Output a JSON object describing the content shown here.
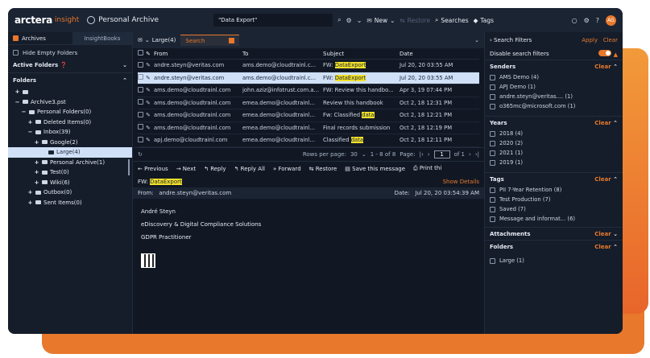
{
  "brand": {
    "name": "arctera",
    "sub": "insight"
  },
  "app_title": "Personal Archive",
  "top_search": {
    "value": "\"Data Export\""
  },
  "toolbar": {
    "new": "New",
    "restore": "Restore",
    "searches": "Searches",
    "tags": "Tags",
    "avatar": "AG"
  },
  "left_tabs": {
    "archives": "Archives",
    "insightbooks": "InsightBooks"
  },
  "hide_empty": "Hide Empty Folders",
  "active_folders": "Active Folders",
  "folders_label": "Folders",
  "tree": [
    {
      "label": "",
      "indent": 0,
      "pm": "+"
    },
    {
      "label": "Archive3.pst",
      "indent": 0,
      "pm": "−"
    },
    {
      "label": "Personal Folders(0)",
      "indent": 1,
      "pm": "−"
    },
    {
      "label": "Deleted Items(0)",
      "indent": 2,
      "pm": "+"
    },
    {
      "label": "Inbox(39)",
      "indent": 2,
      "pm": "−"
    },
    {
      "label": "Google(2)",
      "indent": 3,
      "pm": "+"
    },
    {
      "label": "Large(4)",
      "indent": 4,
      "pm": "",
      "selected": true
    },
    {
      "label": "Personal Archive(1)",
      "indent": 3,
      "pm": "+"
    },
    {
      "label": "Test(0)",
      "indent": 3,
      "pm": "+"
    },
    {
      "label": "Wiki(6)",
      "indent": 3,
      "pm": "+"
    },
    {
      "label": "Outbox(0)",
      "indent": 2,
      "pm": "+"
    },
    {
      "label": "Sent Items(0)",
      "indent": 2,
      "pm": "+"
    }
  ],
  "center_tabs": {
    "folder": "Large(4)",
    "search": "Search"
  },
  "table": {
    "headers": {
      "from": "From",
      "to": "To",
      "subject": "Subject",
      "date": "Date"
    },
    "rows": [
      {
        "from": "andre.steyn@veritas.com",
        "to": "ams.demo@cloudtrainl.c...",
        "sub_pre": "FW: ",
        "sub_hl": [
          "Data",
          "Export"
        ],
        "sub_post": "",
        "date": "Jul 20, 20 03:55 AM",
        "selected": false
      },
      {
        "from": "andre.steyn@veritas.com",
        "to": "ams.demo@cloudtrainl.c...",
        "sub_pre": "FW: ",
        "sub_hl": [
          "Data",
          "Export"
        ],
        "sub_post": "",
        "date": "Jul 20, 20 03:55 AM",
        "selected": true
      },
      {
        "from": "ams.demo@cloudtrainl.com",
        "to": "john.aziz@infotrust.com.a...",
        "sub_pre": "FW: Review this handbo...",
        "sub_hl": [],
        "sub_post": "",
        "date": "Apr 3, 19 07:44 PM",
        "selected": false
      },
      {
        "from": "ams.demo@cloudtrainl.com",
        "to": "emea.demo@cloudtrainl...",
        "sub_pre": "Review this handbook",
        "sub_hl": [],
        "sub_post": "",
        "date": "Oct 2, 18 12:31 PM",
        "selected": false
      },
      {
        "from": "ams.demo@cloudtrainl.com",
        "to": "emea.demo@cloudtrainl...",
        "sub_pre": "Fw: Classified ",
        "sub_hl": [
          "data"
        ],
        "sub_post": "",
        "date": "Oct 2, 18 12:21 PM",
        "selected": false
      },
      {
        "from": "ams.demo@cloudtrainl.com",
        "to": "emea.demo@cloudtrainl...",
        "sub_pre": "Final records submission",
        "sub_hl": [],
        "sub_post": "",
        "date": "Oct 2, 18 12:19 PM",
        "selected": false
      },
      {
        "from": "apj.demo@cloudtrainl.com",
        "to": "emea.demo@cloudtrainl...",
        "sub_pre": "Classified ",
        "sub_hl": [
          "data"
        ],
        "sub_post": "",
        "date": "Oct 2, 18 12:11 PM",
        "selected": false
      }
    ]
  },
  "pager": {
    "rows_label": "Rows per page:",
    "rows_value": "30",
    "range": "1 - 8 of 8",
    "page_label": "Page:",
    "page_value": "1",
    "of": "of 1"
  },
  "actions": {
    "previous": "Previous",
    "next": "Next",
    "reply": "Reply",
    "reply_all": "Reply All",
    "forward": "Forward",
    "restore": "Restore",
    "save": "Save this message",
    "print": "Print thi"
  },
  "message": {
    "subject_pre": "FW:",
    "subject_hl": [
      "Data",
      "Export"
    ],
    "show_details": "Show Details",
    "from_label": "From:",
    "from_value": "andre.steyn@veritas.com",
    "date_label": "Date:",
    "date_value": "Jul 20, 20 03:54:39 AM",
    "body": [
      "André Steyn",
      "eDiscovery & Digital Compliance Solutions",
      "GDPR Practitioner"
    ]
  },
  "filters": {
    "title": "Search Filters",
    "apply": "Apply",
    "clear": "Clear",
    "disable": "Disable search filters",
    "senders_label": "Senders",
    "senders": [
      "AMS Demo (4)",
      "APJ Demo (1)",
      "andre.steyn@veritas.... (1)",
      "o365mc@microsoft.com (1)"
    ],
    "years_label": "Years",
    "years": [
      "2018 (4)",
      "2020 (2)",
      "2021 (1)",
      "2019 (1)"
    ],
    "tags_label": "Tags",
    "tags": [
      "PII 7-Year Retention (8)",
      "Test Production (7)",
      "Saved (7)",
      "Message and informat... (6)"
    ],
    "attachments_label": "Attachments",
    "folders_label": "Folders",
    "folders": [
      "Large (1)"
    ]
  }
}
